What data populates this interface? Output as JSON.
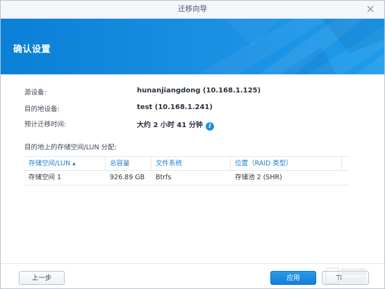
{
  "window": {
    "title": "迁移向导"
  },
  "banner": {
    "heading": "确认设置"
  },
  "details": {
    "source_label": "源设备:",
    "source_value": "hunanjiangdong (10.168.1.125)",
    "dest_label": "目的地设备:",
    "dest_value": "test (10.168.1.241)",
    "time_label": "预计迁移时间:",
    "time_value": "大约 2 小时 41 分钟"
  },
  "allocation_label": "目的地上的存储空间/LUN 分配:",
  "table": {
    "headers": [
      "存储空间/LUN",
      "总容量",
      "文件系统",
      "位置（RAID 类型）"
    ],
    "rows": [
      [
        "存储空间 1",
        "926.89 GB",
        "Btrfs",
        "存储池 2 (SHR)"
      ]
    ]
  },
  "footer": {
    "back_label": "上一步",
    "apply_label": "应用",
    "cancel_label": "Ti"
  },
  "colors": {
    "banner": "#0a7fd6",
    "accent": "#1e8fe0",
    "header_text": "#1e7fd0"
  },
  "icons": {
    "close": "close-icon",
    "info": "info-icon",
    "sort": "sort-asc-icon"
  }
}
